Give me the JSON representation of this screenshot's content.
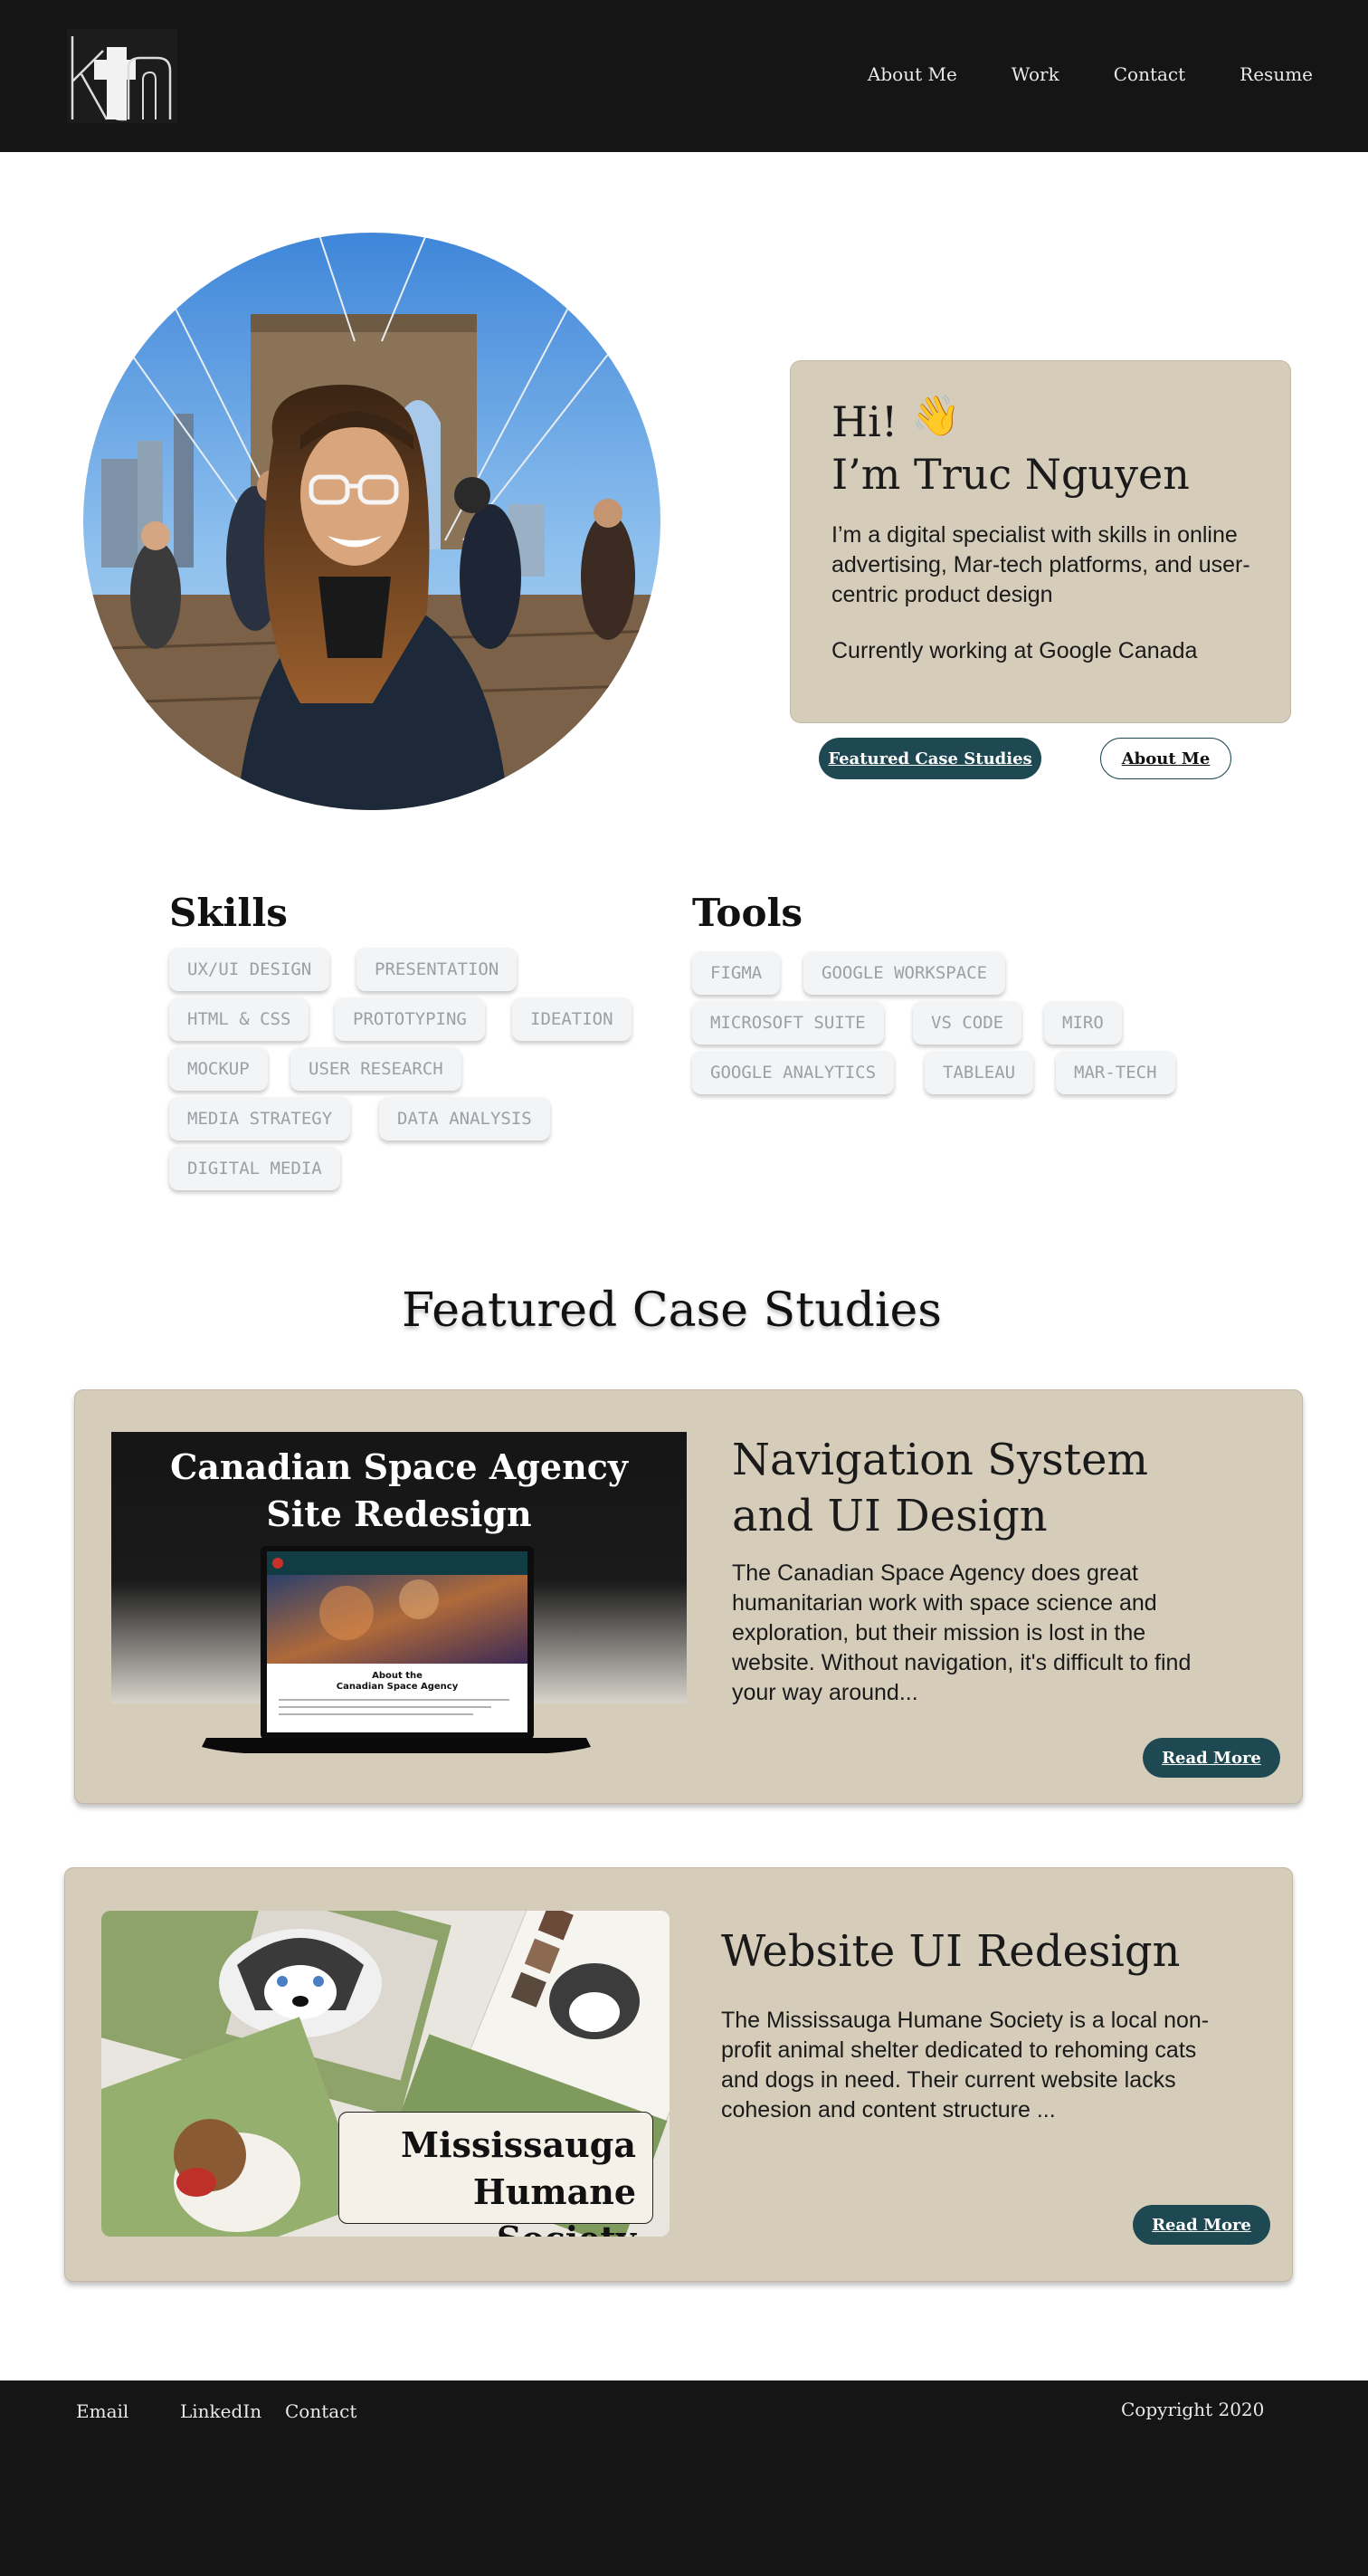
{
  "header": {
    "logo_text": "ktn",
    "nav": [
      "About Me",
      "Work",
      "Contact",
      "Resume"
    ]
  },
  "hero": {
    "greeting": "Hi!",
    "wave_emoji": "👋",
    "name": "I’m Truc Nguyen",
    "intro": "I’m a digital specialist with skills in online advertising, Mar-tech platforms, and user-centric product design",
    "current": "Currently working at Google Canada",
    "btn_featured": "Featured Case Studies",
    "btn_about": "About Me"
  },
  "skills": {
    "title": "Skills",
    "items": [
      "UX/UI DESIGN",
      "PRESENTATION",
      "HTML & CSS",
      "PROTOTYPING",
      "IDEATION",
      "MOCKUP",
      "USER RESEARCH",
      "MEDIA STRATEGY",
      "DATA ANALYSIS",
      "DIGITAL MEDIA"
    ]
  },
  "tools": {
    "title": "Tools",
    "items": [
      "FIGMA",
      "GOOGLE WORKSPACE",
      "MICROSOFT SUITE",
      "VS CODE",
      "MIRO",
      "GOOGLE ANALYTICS",
      "TABLEAU",
      "MAR-TECH"
    ]
  },
  "featured": {
    "heading": "Featured Case Studies",
    "cases": [
      {
        "image_title_1": "Canadian Space Agency",
        "image_title_2": "Site Redesign",
        "screen_heading": "About the",
        "screen_subheading": "Canadian Space Agency",
        "title": "Navigation System and UI Design",
        "description": "The Canadian Space Agency does great humanitarian work with space science and exploration, but their mission is lost in the website. Without navigation, it's difficult to find your way around...",
        "button": "Read More"
      },
      {
        "image_title_1": "Mississauga",
        "image_title_2": "Humane Society",
        "title": "Website UI Redesign",
        "description": "The Mississauga Humane Society is a local non-profit animal shelter dedicated to rehoming cats and dogs in need. Their current website lacks cohesion and content structure ...",
        "button": "Read More"
      }
    ]
  },
  "footer": {
    "links": [
      "Email",
      "LinkedIn",
      "Contact"
    ],
    "copyright": "Copyright 2020"
  },
  "colors": {
    "header_bg": "#151515",
    "card_bg": "#d5ccba",
    "accent_teal": "#1e4852",
    "chip_bg": "#f2f4f6",
    "chip_text": "#9aa0a6"
  }
}
